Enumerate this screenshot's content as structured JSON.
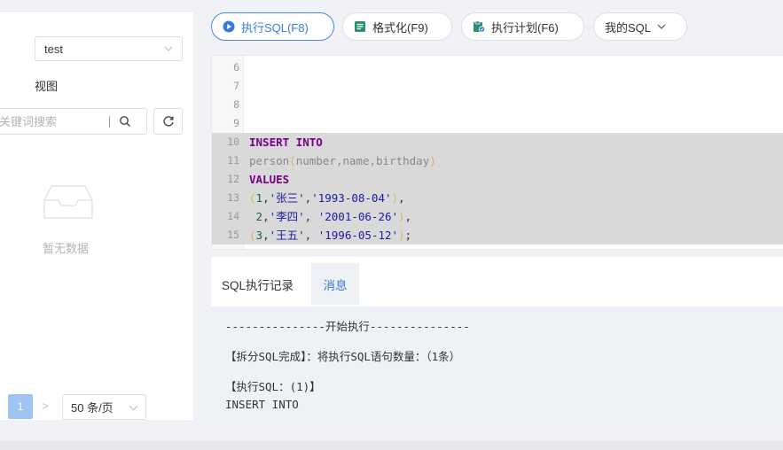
{
  "sidebar": {
    "database": "test",
    "view_label": "视图",
    "search_placeholder": "关键词搜索",
    "empty_text": "暂无数据",
    "pager": {
      "current_page": "1",
      "next_symbol": ">",
      "page_size": "50 条/页"
    }
  },
  "toolbar": {
    "execute": "执行SQL(F8)",
    "format": "格式化(F9)",
    "plan": "执行计划(F6)",
    "my_sql": "我的SQL"
  },
  "editor": {
    "lines": [
      {
        "n": "6",
        "selected": false,
        "tokens": []
      },
      {
        "n": "7",
        "selected": false,
        "tokens": []
      },
      {
        "n": "8",
        "selected": false,
        "tokens": []
      },
      {
        "n": "9",
        "selected": false,
        "tokens": []
      },
      {
        "n": "10",
        "selected": true,
        "tokens": [
          {
            "t": "kw",
            "v": "INSERT INTO"
          }
        ]
      },
      {
        "n": "11",
        "selected": true,
        "tokens": [
          {
            "t": "ident",
            "v": "person"
          },
          {
            "t": "paren",
            "v": "("
          },
          {
            "t": "ident",
            "v": "number,name,birthday"
          },
          {
            "t": "paren",
            "v": ")"
          }
        ]
      },
      {
        "n": "12",
        "selected": true,
        "tokens": [
          {
            "t": "kw",
            "v": "VALUES"
          }
        ]
      },
      {
        "n": "13",
        "selected": true,
        "tokens": [
          {
            "t": "paren",
            "v": "("
          },
          {
            "t": "num",
            "v": "1"
          },
          {
            "t": "plain",
            "v": ","
          },
          {
            "t": "str",
            "v": "'张三'"
          },
          {
            "t": "plain",
            "v": ","
          },
          {
            "t": "str",
            "v": "'1993-08-04'"
          },
          {
            "t": "paren",
            "v": ")"
          },
          {
            "t": "plain",
            "v": ","
          }
        ]
      },
      {
        "n": "14",
        "selected": true,
        "tokens": [
          {
            "t": "plain",
            "v": " "
          },
          {
            "t": "num",
            "v": "2"
          },
          {
            "t": "plain",
            "v": ","
          },
          {
            "t": "str",
            "v": "'李四'"
          },
          {
            "t": "plain",
            "v": ", "
          },
          {
            "t": "str",
            "v": "'2001-06-26'"
          },
          {
            "t": "paren",
            "v": ")"
          },
          {
            "t": "plain",
            "v": ","
          }
        ]
      },
      {
        "n": "15",
        "selected": true,
        "tokens": [
          {
            "t": "paren",
            "v": "("
          },
          {
            "t": "num",
            "v": "3"
          },
          {
            "t": "plain",
            "v": ","
          },
          {
            "t": "str",
            "v": "'王五'"
          },
          {
            "t": "plain",
            "v": ", "
          },
          {
            "t": "str",
            "v": "'1996-05-12'"
          },
          {
            "t": "paren",
            "v": ")"
          },
          {
            "t": "plain",
            "v": ";"
          }
        ]
      }
    ]
  },
  "result": {
    "tabs": [
      {
        "label": "SQL执行记录",
        "active": false
      },
      {
        "label": "消息",
        "active": true
      }
    ],
    "messages": [
      "---------------开始执行---------------",
      "【拆分SQL完成】：将执行SQL语句数量：（1条）",
      "【执行SQL：(1)】",
      "INSERT INTO"
    ]
  },
  "colors": {
    "accent": "#3a7bd5",
    "keyword": "#770088",
    "string": "#1a1aa6",
    "number": "#116644",
    "selection": "#d9d9d9"
  }
}
